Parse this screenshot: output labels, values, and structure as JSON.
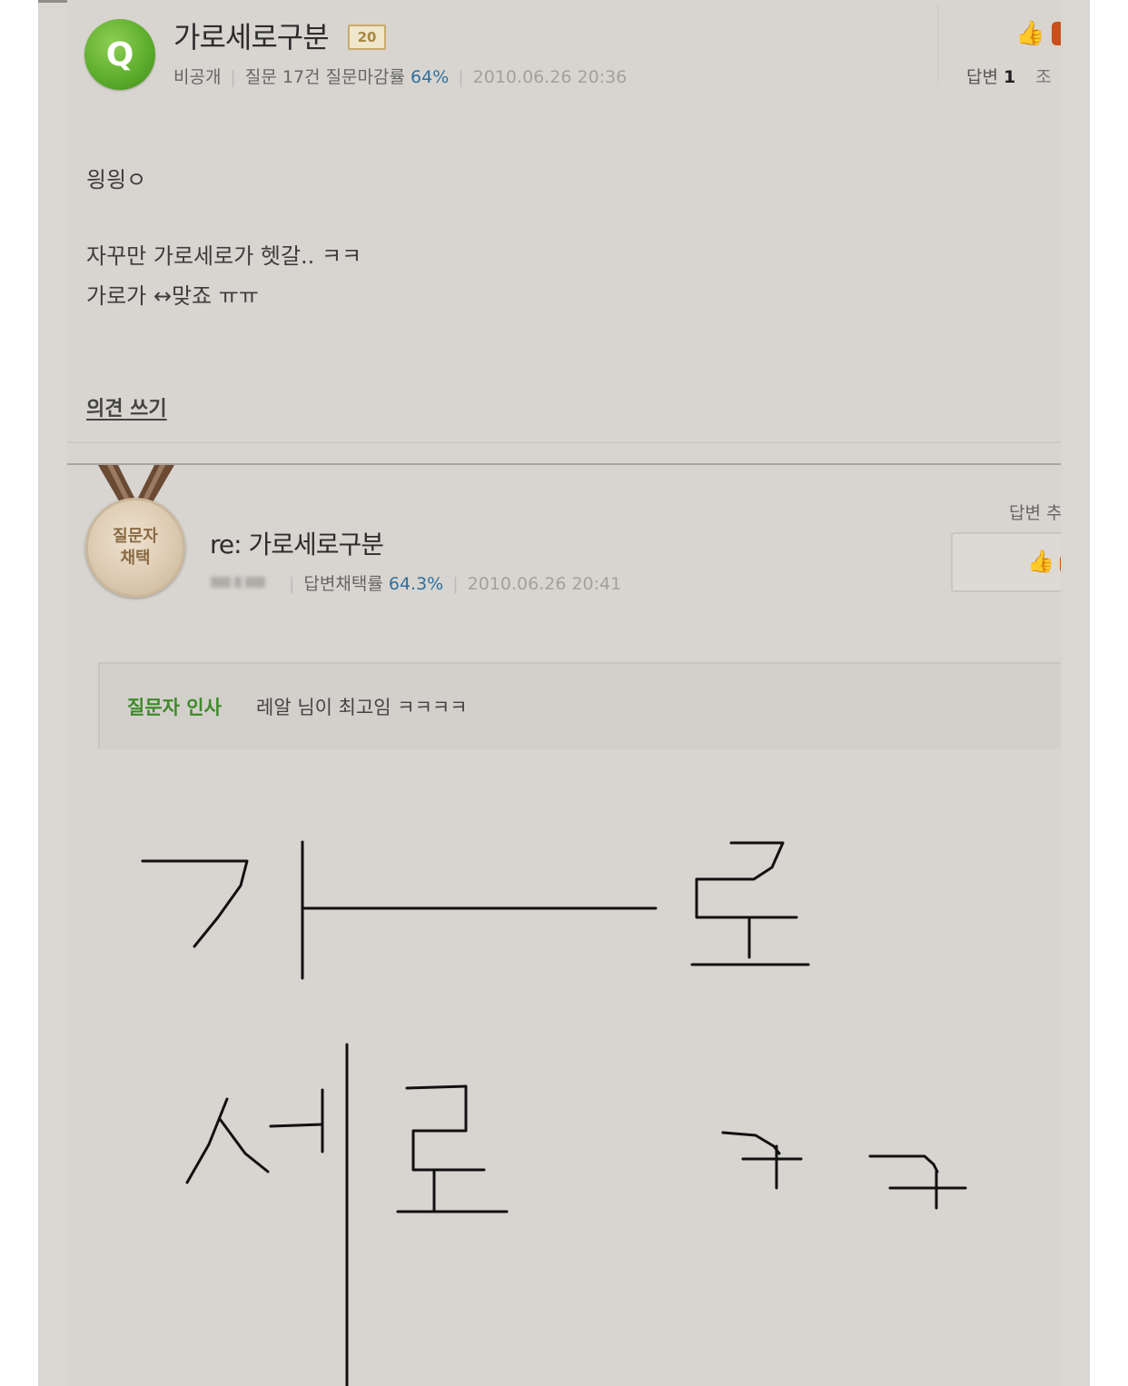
{
  "question": {
    "icon_letter": "Q",
    "title": "가로세로구분",
    "level_badge": "20",
    "visibility": "비공개",
    "question_count_label": "질문 17건",
    "close_rate_label": "질문마감률",
    "close_rate_value": "64%",
    "date": "2010.06.26 20:36",
    "answers_label": "답변",
    "answers_count": "1",
    "more_label": "조",
    "body_lines": [
      "읭읭ㅇ",
      "자꾸만 가로세로가 헷갈.. ㅋㅋ",
      "가로가 ↔맞죠 ㅠㅠ"
    ],
    "opinion_link": "의견 쓰기"
  },
  "answer": {
    "medal_line1": "질문자",
    "medal_line2": "채택",
    "title": "re: 가로세로구분",
    "adopt_rate_label": "답변채택률",
    "adopt_rate_value": "64.3%",
    "date": "2010.06.26 20:41",
    "side_label": "답변 추",
    "thanks_label": "질문자 인사",
    "thanks_text": "레알 님이 최고임 ㅋㅋㅋㅋ"
  },
  "colors": {
    "accent_blue": "#2f6f9c",
    "accent_green": "#3f8a2a",
    "like_orange": "#c8501a"
  },
  "icons": {
    "thumb": "thumbs-up-icon",
    "question": "q-circle-icon",
    "medal": "medal-icon"
  }
}
